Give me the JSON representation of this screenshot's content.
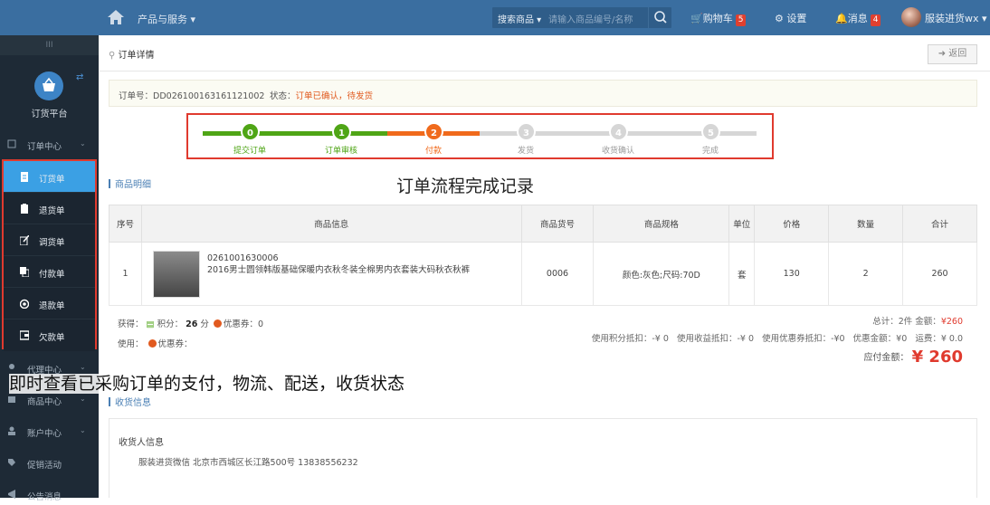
{
  "topbar": {
    "products_menu": "产品与服务 ▾",
    "search_category": "搜索商品 ▾",
    "search_placeholder": "请输入商品编号/名称",
    "cart_label": "购物车",
    "cart_count": "5",
    "settings_label": "设置",
    "messages_label": "消息",
    "messages_count": "4",
    "user_name": "服装进货wx ▾"
  },
  "sidebar": {
    "grip": "III",
    "platform_label": "订货平台",
    "sections": [
      {
        "label": "订单中心"
      },
      {
        "label": "代理中心"
      },
      {
        "label": "商品中心"
      },
      {
        "label": "账户中心"
      },
      {
        "label": "促销活动"
      },
      {
        "label": "公告消息"
      }
    ],
    "sub_items": [
      {
        "label": "订货单"
      },
      {
        "label": "退货单"
      },
      {
        "label": "调货单"
      },
      {
        "label": "付款单"
      },
      {
        "label": "退款单"
      },
      {
        "label": "欠款单"
      }
    ]
  },
  "page": {
    "breadcrumb": "订单详情",
    "back_label": "返回",
    "order_no_label": "订单号：",
    "order_no": "DD026100163161121002",
    "status_label": "状态：",
    "status_value": "订单已确认，待发货"
  },
  "progress": {
    "steps": [
      {
        "num": "0",
        "label": "提交订单"
      },
      {
        "num": "1",
        "label": "订单审核"
      },
      {
        "num": "2",
        "label": "付款"
      },
      {
        "num": "3",
        "label": "发货"
      },
      {
        "num": "4",
        "label": "收货确认"
      },
      {
        "num": "5",
        "label": "完成"
      }
    ],
    "colors": {
      "done": "#4fa516",
      "current": "#f06a1c",
      "todo": "#d6d6d6"
    }
  },
  "captions": {
    "flow": "订单流程完成记录",
    "tracking": "即时查看已采购订单的支付，物流、配送，收货状态"
  },
  "goods": {
    "title": "商品明细",
    "columns": [
      "序号",
      "商品信息",
      "商品货号",
      "商品规格",
      "单位",
      "价格",
      "数量",
      "合计"
    ],
    "rows": [
      {
        "index": "1",
        "code": "0261001630006",
        "name": "2016男士圆领韩版基础保暖内衣秋冬装全棉男内衣套装大码秋衣秋裤",
        "sku": "0006",
        "spec": "颜色:灰色;尺码:70D",
        "unit": "套",
        "price": "130",
        "qty": "2",
        "total": "260"
      }
    ]
  },
  "summary": {
    "earn_label": "获得：",
    "points_label": "积分：",
    "points_value": "26",
    "points_unit": "分",
    "coupon_label": "优惠券：",
    "coupon_value": "0",
    "use_label": "使用：",
    "use_coupon_label": "优惠券：",
    "total_items": "总计：2件",
    "amount_label": "金额：",
    "amount_value": "¥260",
    "points_deduct": "使用积分抵扣：-¥ 0",
    "income_deduct": "使用收益抵扣：-¥ 0",
    "coupon_deduct": "使用优惠券抵扣：-¥0",
    "discount": "优惠金额：¥0",
    "freight": "运费：¥ 0.0",
    "payable_label": "应付金额：",
    "payable_value": "¥ 260"
  },
  "receiving": {
    "section_title": "收货信息",
    "heading": "收货人信息",
    "line": "服装进货微信    北京市西城区长江路500号    13838556232"
  }
}
